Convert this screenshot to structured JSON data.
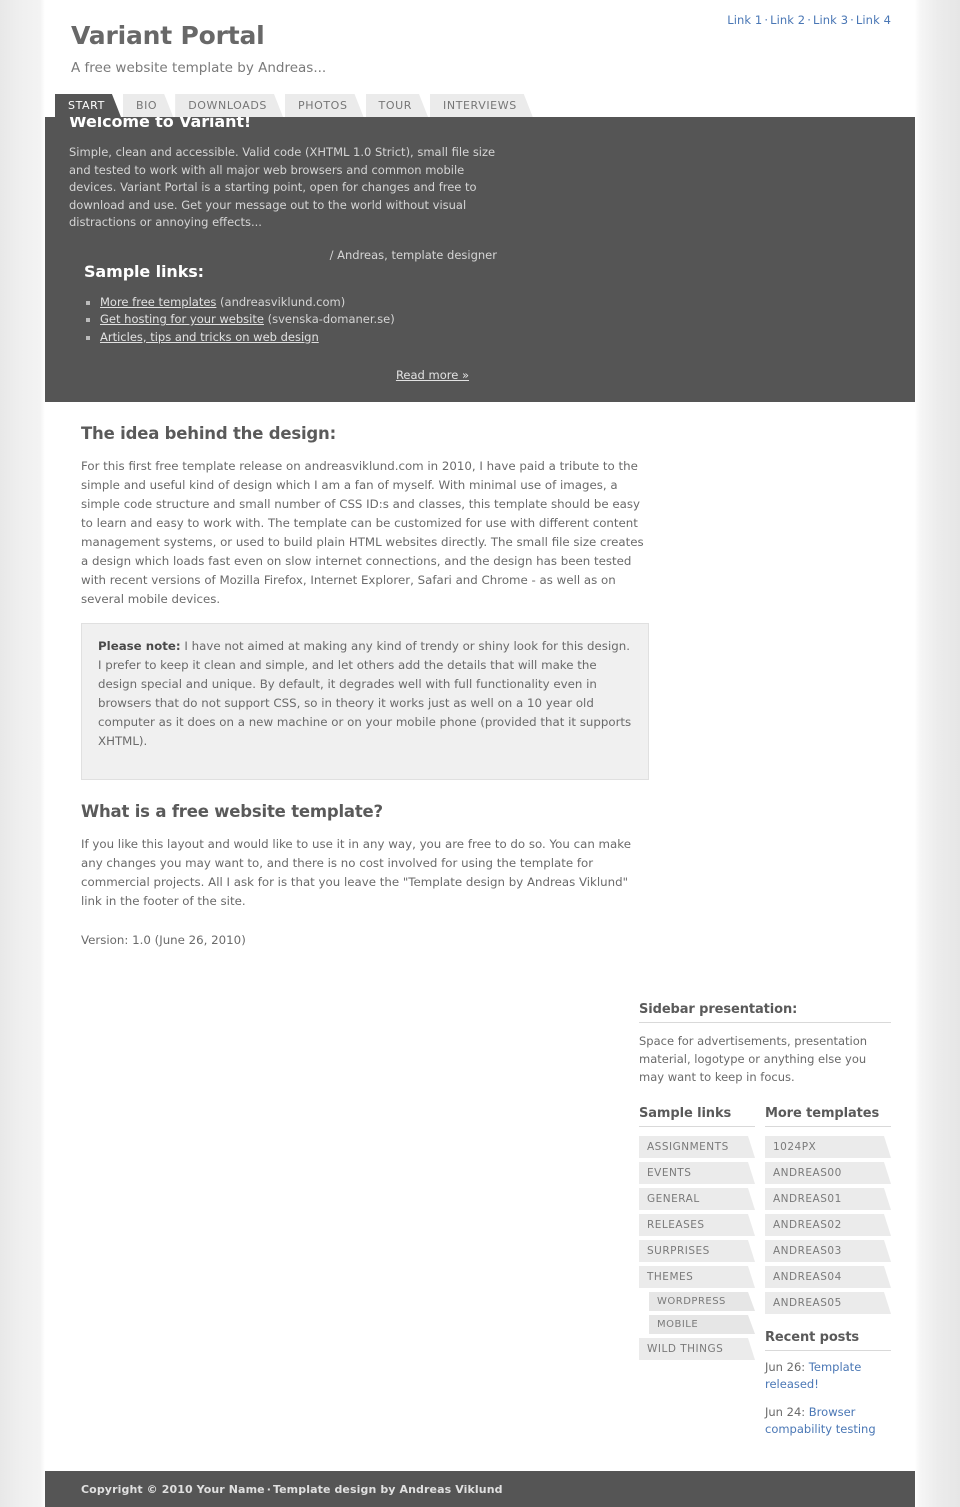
{
  "header": {
    "site_title": "Variant Portal",
    "tagline": "A free website template by Andreas...",
    "top_links": [
      {
        "label": "Link 1"
      },
      {
        "label": "Link 2"
      },
      {
        "label": "Link 3"
      },
      {
        "label": "Link 4"
      }
    ],
    "top_link_separator": "·"
  },
  "tabs": [
    {
      "label": "START",
      "active": true
    },
    {
      "label": "BIO",
      "active": false
    },
    {
      "label": "DOWNLOADS",
      "active": false
    },
    {
      "label": "PHOTOS",
      "active": false
    },
    {
      "label": "TOUR",
      "active": false
    },
    {
      "label": "INTERVIEWS",
      "active": false
    }
  ],
  "banner": {
    "heading": "Welcome to Variant!",
    "body": "Simple, clean and accessible. Valid code (XHTML 1.0 Strict), small file size and tested to work with all major web browsers and common mobile devices. Variant Portal is a starting point, open for changes and free to download and use. Get your message out to the world without visual distractions or annoying effects...",
    "signature": "/ Andreas, template designer",
    "links_heading": "Sample links:",
    "links": [
      {
        "link_text": "More free templates",
        "suffix": " (andreasviklund.com)"
      },
      {
        "link_text": "Get hosting for your website",
        "suffix": " (svenska-domaner.se)"
      },
      {
        "link_text": "Articles, tips and tricks on web design",
        "suffix": ""
      }
    ],
    "read_more": "Read more »"
  },
  "content": {
    "heading1": "The idea behind the design:",
    "paragraph1": "For this first free template release on andreasviklund.com in 2010, I have paid a tribute to the simple and useful kind of design which I am a fan of myself. With minimal use of images, a simple code structure and small number of CSS ID:s and classes, this template should be easy to learn and easy to work with. The template can be customized for use with different content management systems, or used to build plain HTML websites directly. The small file size creates a design which loads fast even on slow internet connections, and the design has been tested with recent versions of Mozilla Firefox, Internet Explorer, Safari and Chrome - as well as on several mobile devices.",
    "note_label": "Please note:",
    "note_text": " I have not aimed at making any kind of trendy or shiny look for this design. I prefer to keep it clean and simple, and let others add the details that will make the design special and unique. By default, it degrades well with full functionality even in browsers that do not support CSS, so in theory it works just as well on a 10 year old computer as it does on a new machine or on your mobile phone (provided that it supports XHTML).",
    "heading2": "What is a free website template?",
    "paragraph2": "If you like this layout and would like to use it in any way, you are free to do so. You can make any changes you may want to, and there is no cost involved for using the template for commercial projects. All I ask for is that you leave the \"Template design by Andreas Viklund\" link in the footer of the site.",
    "version": "Version: 1.0 (June 26, 2010)"
  },
  "sidebar": {
    "presentation_heading": "Sidebar presentation:",
    "presentation_text": "Space for advertisements, presentation material, logotype or anything else you may want to keep in focus.",
    "sample_links_heading": "Sample links",
    "sample_links": [
      {
        "label": "ASSIGNMENTS",
        "children": []
      },
      {
        "label": "EVENTS",
        "children": []
      },
      {
        "label": "GENERAL",
        "children": []
      },
      {
        "label": "RELEASES",
        "children": []
      },
      {
        "label": "SURPRISES",
        "children": []
      },
      {
        "label": "THEMES",
        "children": [
          {
            "label": "WORDPRESS"
          },
          {
            "label": "MOBILE"
          }
        ]
      },
      {
        "label": "WILD THINGS",
        "children": []
      }
    ],
    "more_templates_heading": "More templates",
    "more_templates": [
      {
        "label": "1024PX"
      },
      {
        "label": "ANDREAS00"
      },
      {
        "label": "ANDREAS01"
      },
      {
        "label": "ANDREAS02"
      },
      {
        "label": "ANDREAS03"
      },
      {
        "label": "ANDREAS04"
      },
      {
        "label": "ANDREAS05"
      }
    ],
    "recent_posts_heading": "Recent posts",
    "recent_posts": [
      {
        "date": "Jun 26: ",
        "title": "Template released!"
      },
      {
        "date": "Jun 24: ",
        "title": "Browser compability testing"
      }
    ]
  },
  "footer": {
    "copyright": "Copyright © 2010 Your Name",
    "separator": "·",
    "credit": "Template design by Andreas Viklund"
  },
  "colors": {
    "dark_panel": "#555555",
    "page_bg": "#ffffff",
    "link_blue": "#4a77b5",
    "box_gray": "#ebebeb",
    "note_bg": "#f0f0f0"
  }
}
